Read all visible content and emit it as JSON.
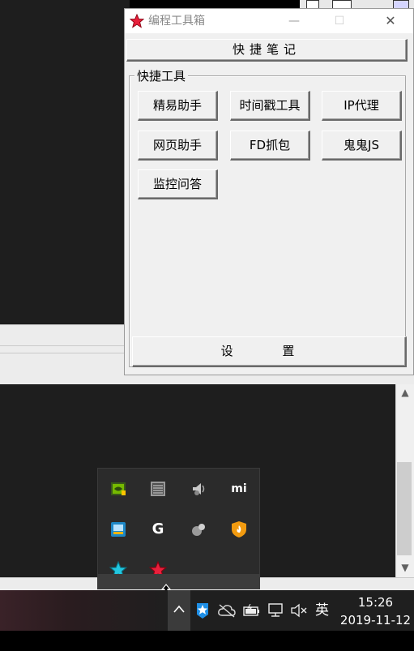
{
  "window": {
    "title": "编程工具箱",
    "min_symbol": "—",
    "max_symbol": "☐",
    "close_symbol": "✕",
    "quick_notes_label": "快捷笔记",
    "group_label": "快捷工具",
    "tools": [
      "精易助手",
      "时间戳工具",
      "IP代理",
      "网页助手",
      "FD抓包",
      "鬼鬼JS",
      "监控问答"
    ],
    "settings_label": "设  置",
    "icon": "red-star-icon"
  },
  "tray": {
    "icons": [
      "nvidia-icon",
      "monitor-list-icon",
      "speaker-icon",
      "mi-icon",
      "network-config-icon",
      "g-logo-icon",
      "gear-ball-icon",
      "shield-flame-icon",
      "cyan-star-icon",
      "red-star-icon"
    ],
    "mi_text": "mi"
  },
  "taskbar": {
    "ime_label": "英",
    "time": "15:26",
    "date": "2019-11-12",
    "icons": [
      "chevron-up-icon",
      "blue-app-icon",
      "cloud-offline-icon",
      "battery-icon",
      "network-icon",
      "volume-muted-icon"
    ]
  },
  "scrollbar": {
    "up": "▲",
    "down": "▼"
  },
  "colors": {
    "taskbar": "#1f1f1f",
    "tray": "#2b2b2b",
    "window_bg": "#f0f0f0",
    "accent_red": "#e8203c",
    "accent_cyan": "#22c7e0"
  }
}
